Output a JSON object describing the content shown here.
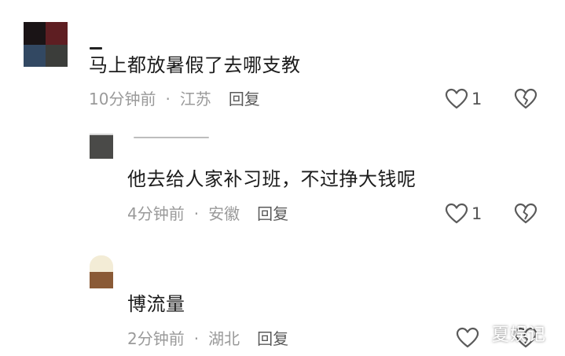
{
  "comments": [
    {
      "text": "马上都放暑假了去哪支教",
      "time": "10分钟前",
      "location": "江苏",
      "reply_label": "回复",
      "like_count": "1",
      "avatar_colors": [
        "#1a1416",
        "#5e1e22",
        "#324862",
        "#3b3d3a"
      ]
    },
    {
      "text": "他去给人家补习班，不过挣大钱呢",
      "time": "4分钟前",
      "location": "安徽",
      "reply_label": "回复",
      "like_count": "1",
      "avatar_colors": [
        "#4a4a48"
      ]
    },
    {
      "text": "博流量",
      "time": "2分钟前",
      "location": "湖北",
      "reply_label": "回复",
      "like_count": "",
      "avatar_colors": [
        "#f3ecd6",
        "#8a5a36"
      ]
    }
  ],
  "separator": "·",
  "watermark": "夏娱记",
  "colors": {
    "meta": "#9a9a9a",
    "text": "#1c1c1c",
    "icon": "#5a5a5a"
  },
  "icons": {
    "like": "heart-outline-icon",
    "dislike": "broken-heart-icon"
  }
}
